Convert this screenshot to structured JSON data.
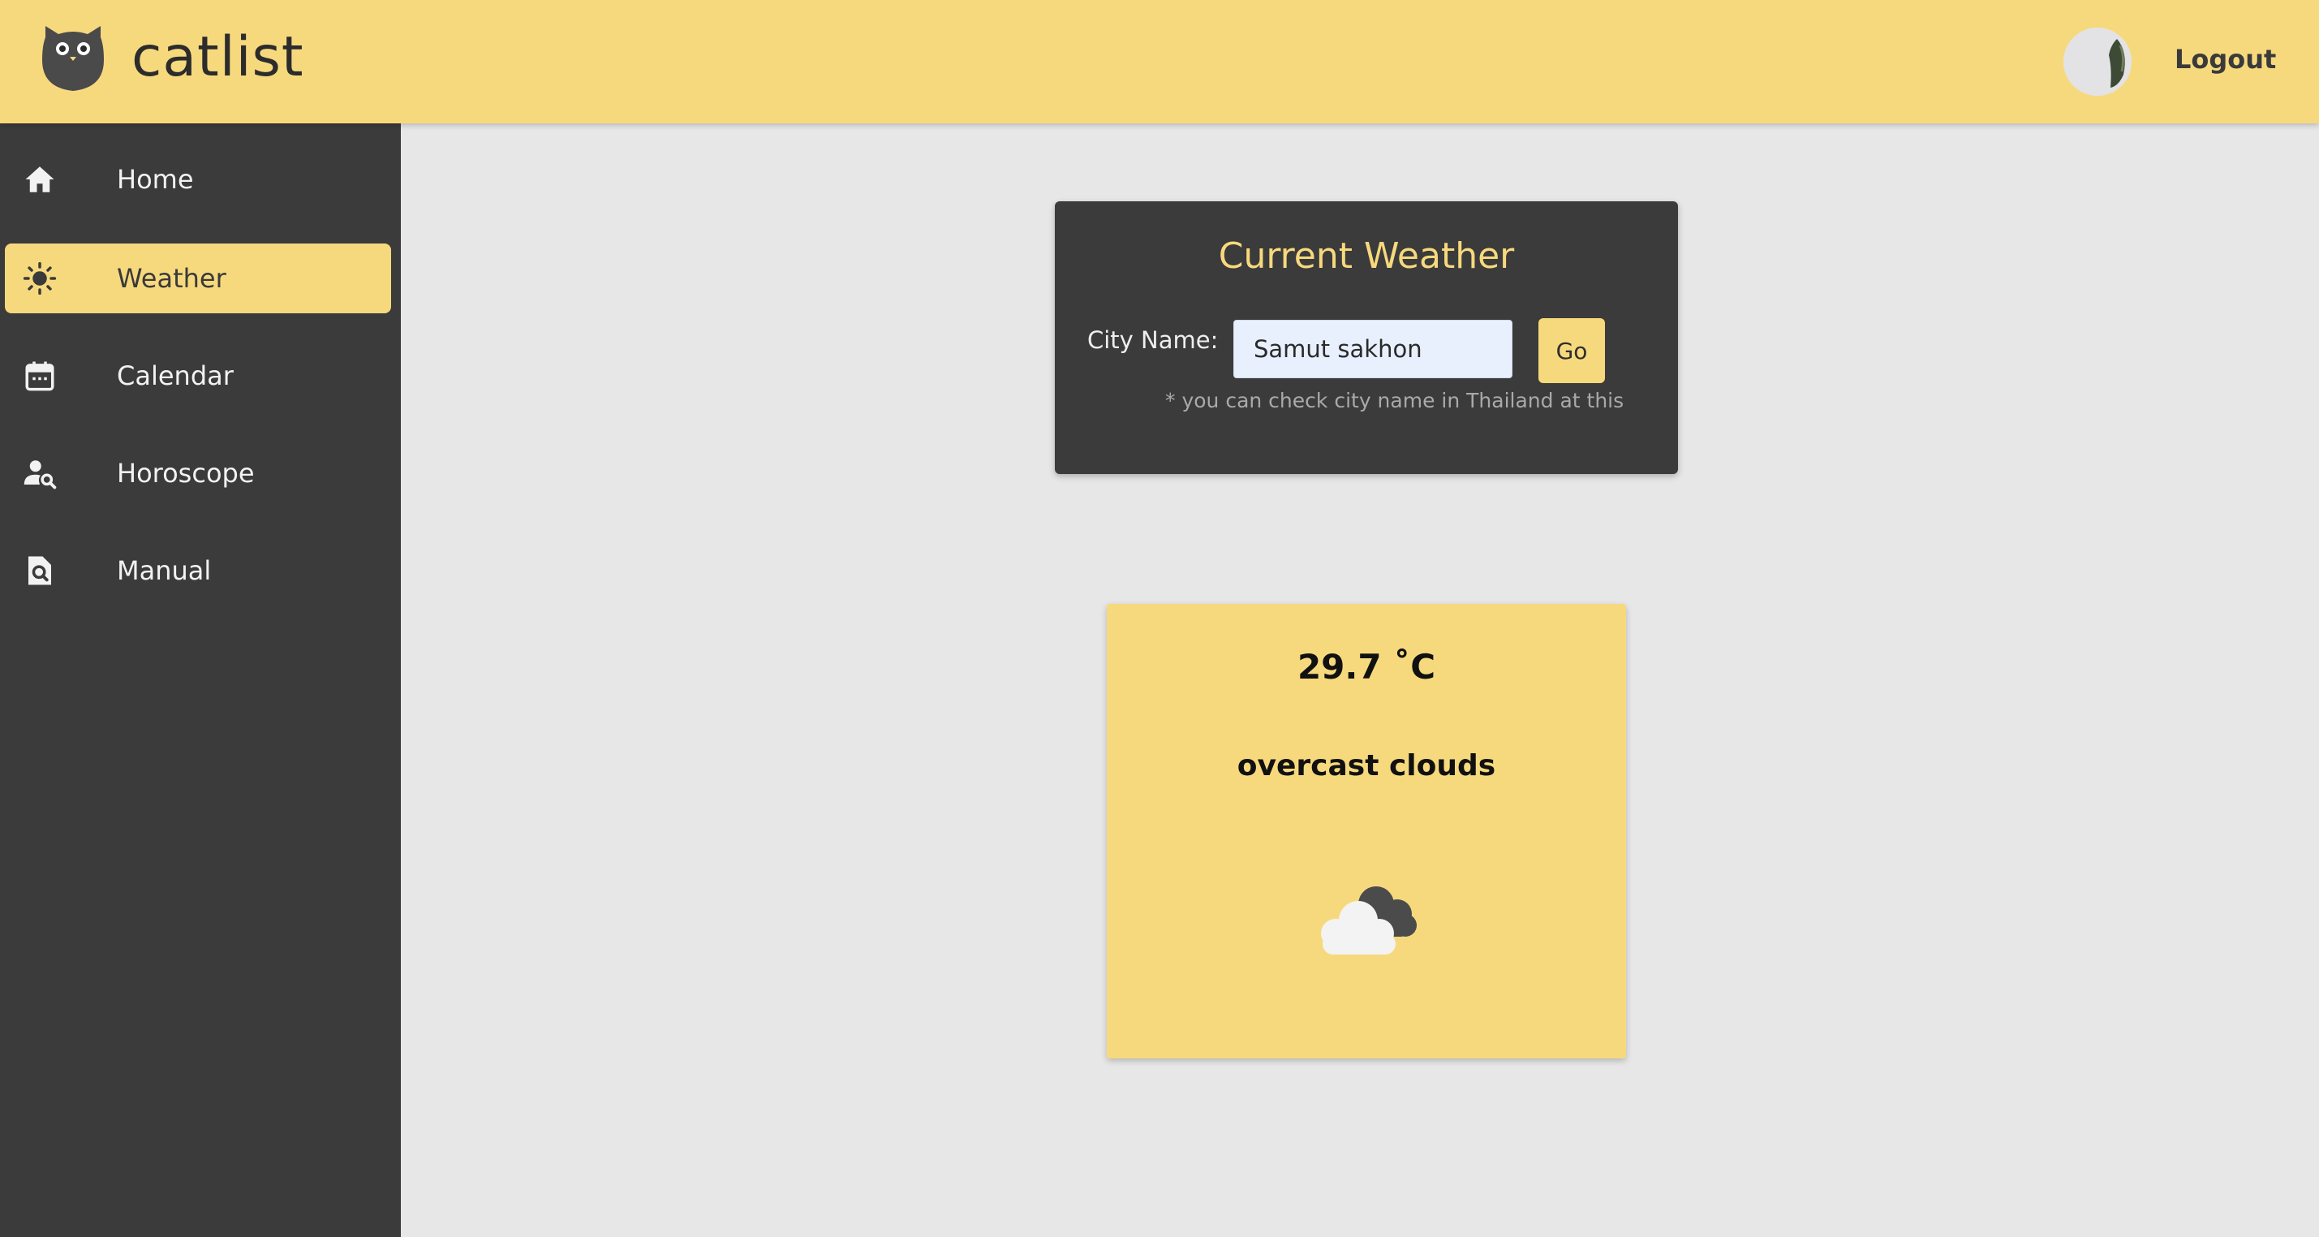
{
  "header": {
    "app_name": "catlist",
    "logout_label": "Logout",
    "logo_icon": "cat-face-icon"
  },
  "sidebar": {
    "items": [
      {
        "label": "Home",
        "icon": "home-icon",
        "active": false
      },
      {
        "label": "Weather",
        "icon": "sun-icon",
        "active": true
      },
      {
        "label": "Calendar",
        "icon": "calendar-icon",
        "active": false
      },
      {
        "label": "Horoscope",
        "icon": "person-search-icon",
        "active": false
      },
      {
        "label": "Manual",
        "icon": "document-search-icon",
        "active": false
      }
    ]
  },
  "weather_form": {
    "title": "Current Weather",
    "city_label": "City Name:",
    "city_value": "Samut sakhon",
    "go_label": "Go",
    "hint": "* you can check city name in Thailand at this"
  },
  "weather_result": {
    "temperature": "29.7 ˚C",
    "description": "overcast clouds",
    "icon": "overcast-clouds-icon"
  },
  "colors": {
    "accent": "#f7d97d",
    "dark": "#3b3b3b",
    "background": "#e7e7e7"
  }
}
